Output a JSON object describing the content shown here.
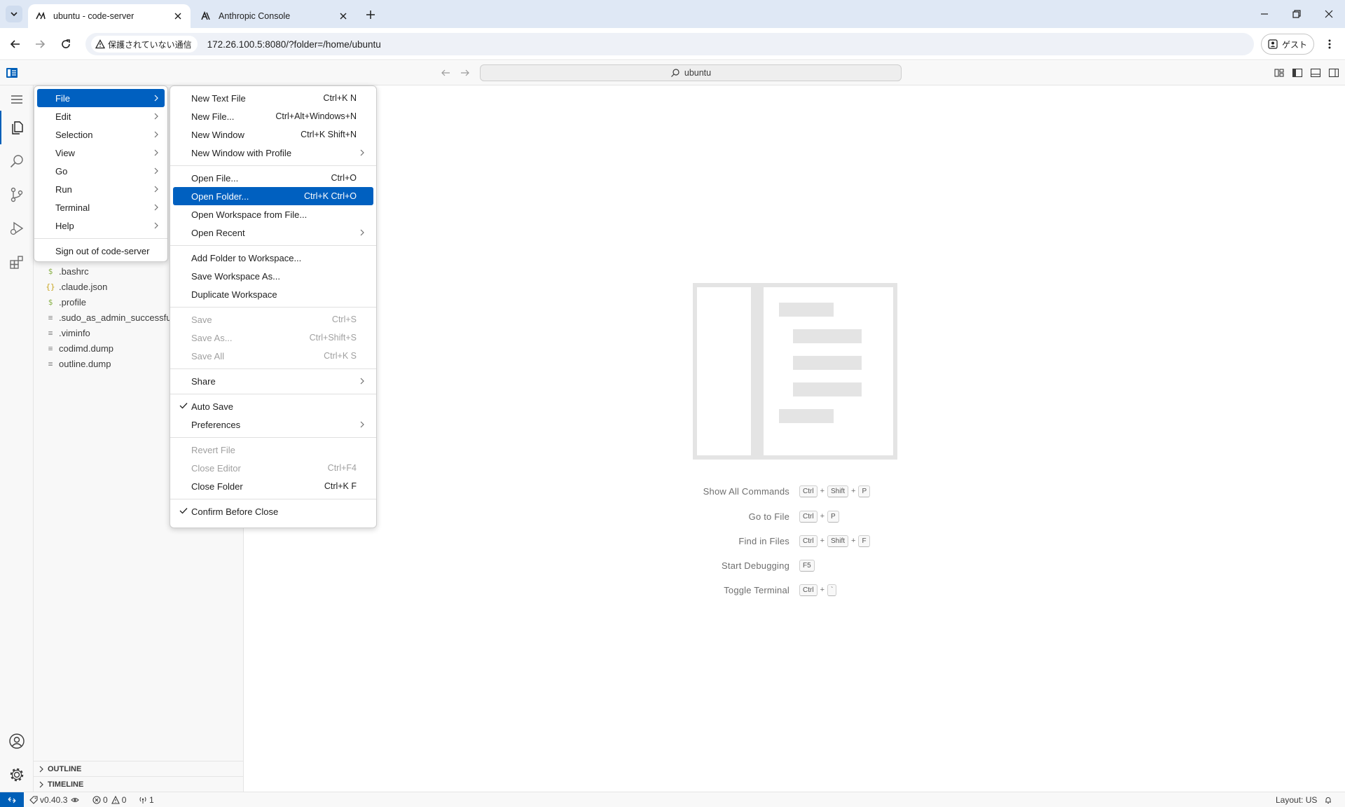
{
  "browser": {
    "tabs": [
      {
        "title": "ubuntu - code-server",
        "active": true
      },
      {
        "title": "Anthropic Console",
        "active": false
      }
    ],
    "security_label": "保護されていない通信",
    "url": "172.26.100.5:8080/?folder=/home/ubuntu",
    "profile_label": "ゲスト"
  },
  "titlebar": {
    "search_text": "ubuntu"
  },
  "explorer": {
    "files": [
      {
        "icon": "$",
        "name": ".bashrc",
        "icon_color": "#89b148"
      },
      {
        "icon": "{}",
        "name": ".claude.json",
        "icon_color": "#c8a521"
      },
      {
        "icon": "$",
        "name": ".profile",
        "icon_color": "#89b148"
      },
      {
        "icon": "≡",
        "name": ".sudo_as_admin_successful",
        "icon_color": "#8a8a8a"
      },
      {
        "icon": "≡",
        "name": ".viminfo",
        "icon_color": "#8a8a8a"
      },
      {
        "icon": "≡",
        "name": "codimd.dump",
        "icon_color": "#8a8a8a"
      },
      {
        "icon": "≡",
        "name": "outline.dump",
        "icon_color": "#8a8a8a"
      }
    ],
    "sections": [
      "OUTLINE",
      "TIMELINE"
    ]
  },
  "app_menu": {
    "items": [
      {
        "label": "File",
        "selected": true
      },
      {
        "label": "Edit"
      },
      {
        "label": "Selection"
      },
      {
        "label": "View"
      },
      {
        "label": "Go"
      },
      {
        "label": "Run"
      },
      {
        "label": "Terminal"
      },
      {
        "label": "Help"
      }
    ],
    "sign_out": "Sign out of code-server"
  },
  "file_menu": {
    "items": [
      {
        "label": "New Text File",
        "shortcut": "Ctrl+K N"
      },
      {
        "label": "New File...",
        "shortcut": "Ctrl+Alt+Windows+N"
      },
      {
        "label": "New Window",
        "shortcut": "Ctrl+K Shift+N"
      },
      {
        "label": "New Window with Profile",
        "shortcut": ""
      },
      {
        "label": "Open File...",
        "shortcut": "Ctrl+O"
      },
      {
        "label": "Open Folder...",
        "shortcut": "Ctrl+K Ctrl+O",
        "selected": true
      },
      {
        "label": "Open Workspace from File...",
        "shortcut": ""
      },
      {
        "label": "Open Recent",
        "shortcut": ""
      },
      {
        "label": "Add Folder to Workspace...",
        "shortcut": ""
      },
      {
        "label": "Save Workspace As...",
        "shortcut": ""
      },
      {
        "label": "Duplicate Workspace",
        "shortcut": ""
      },
      {
        "label": "Save",
        "shortcut": "Ctrl+S",
        "disabled": true
      },
      {
        "label": "Save As...",
        "shortcut": "Ctrl+Shift+S",
        "disabled": true
      },
      {
        "label": "Save All",
        "shortcut": "Ctrl+K S",
        "disabled": true
      },
      {
        "label": "Share",
        "shortcut": ""
      },
      {
        "label": "Auto Save",
        "shortcut": "",
        "checked": true
      },
      {
        "label": "Preferences",
        "shortcut": ""
      },
      {
        "label": "Revert File",
        "shortcut": "",
        "disabled": true
      },
      {
        "label": "Close Editor",
        "shortcut": "Ctrl+F4",
        "disabled": true
      },
      {
        "label": "Close Folder",
        "shortcut": "Ctrl+K F"
      },
      {
        "label": "Confirm Before Close",
        "shortcut": "",
        "checked": true
      }
    ]
  },
  "watermark": {
    "shortcuts": [
      {
        "label": "Show All Commands",
        "keys": [
          "Ctrl",
          "Shift",
          "P"
        ]
      },
      {
        "label": "Go to File",
        "keys": [
          "Ctrl",
          "P"
        ]
      },
      {
        "label": "Find in Files",
        "keys": [
          "Ctrl",
          "Shift",
          "F"
        ]
      },
      {
        "label": "Start Debugging",
        "keys": [
          "F5"
        ]
      },
      {
        "label": "Toggle Terminal",
        "keys": [
          "Ctrl",
          "`"
        ]
      }
    ]
  },
  "statusbar": {
    "version": "v0.40.3",
    "errors": "0",
    "warnings": "0",
    "ports": "1",
    "layout": "Layout: US"
  },
  "colors": {
    "accent": "#005fb8",
    "menu_selected": "#0060c0"
  }
}
